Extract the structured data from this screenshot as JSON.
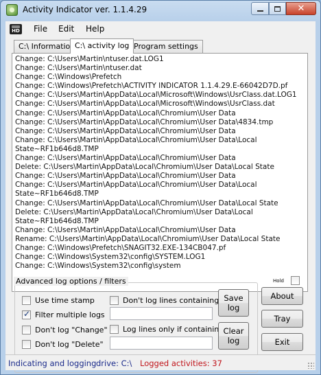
{
  "window": {
    "title": "Activity Indicator ver. 1.1.4.29"
  },
  "menu": {
    "file": "File",
    "edit": "Edit",
    "help": "Help",
    "logo_text": "HD"
  },
  "tabs": {
    "information": "C:\\ Information",
    "activity_log": "C:\\ activity log",
    "program_settings": "Program settings"
  },
  "log_lines": [
    "Change: C:\\Users\\Martin\\ntuser.dat.LOG1",
    "Change: C:\\Users\\Martin\\ntuser.dat",
    "Change: C:\\Windows\\Prefetch",
    "Change: C:\\Windows\\Prefetch\\ACTIVITY INDICATOR 1.1.4.29.E-66042D7D.pf",
    "Change: C:\\Users\\Martin\\AppData\\Local\\Microsoft\\Windows\\UsrClass.dat.LOG1",
    "Change: C:\\Users\\Martin\\AppData\\Local\\Microsoft\\Windows\\UsrClass.dat",
    "Change: C:\\Users\\Martin\\AppData\\Local\\Chromium\\User Data",
    "Change: C:\\Users\\Martin\\AppData\\Local\\Chromium\\User Data\\4834.tmp",
    "Change: C:\\Users\\Martin\\AppData\\Local\\Chromium\\User Data",
    "Change: C:\\Users\\Martin\\AppData\\Local\\Chromium\\User Data\\Local",
    "State~RF1b646d8.TMP",
    "Change: C:\\Users\\Martin\\AppData\\Local\\Chromium\\User Data",
    "Delete: C:\\Users\\Martin\\AppData\\Local\\Chromium\\User Data\\Local State",
    "Change: C:\\Users\\Martin\\AppData\\Local\\Chromium\\User Data",
    "Change: C:\\Users\\Martin\\AppData\\Local\\Chromium\\User Data\\Local",
    "State~RF1b646d8.TMP",
    "Change: C:\\Users\\Martin\\AppData\\Local\\Chromium\\User Data\\Local State",
    "Delete: C:\\Users\\Martin\\AppData\\Local\\Chromium\\User Data\\Local",
    "State~RF1b646d8.TMP",
    "Change: C:\\Users\\Martin\\AppData\\Local\\Chromium\\User Data",
    "Rename: C:\\Users\\Martin\\AppData\\Local\\Chromium\\User Data\\Local State",
    "Change: C:\\Windows\\Prefetch\\SNAGIT32.EXE-134CB047.pf",
    "Change: C:\\Windows\\System32\\config\\SYSTEM.LOG1",
    "Change: C:\\Windows\\System32\\config\\system"
  ],
  "hold_label": "Hold",
  "options": {
    "group_title": "Advanced log options / filters",
    "use_time_stamp": {
      "label": "Use time stamp",
      "checked": false
    },
    "filter_multiple_logs": {
      "label": "Filter multiple logs",
      "checked": true
    },
    "dont_log_change": {
      "label": "Don't log \"Change\"",
      "checked": false
    },
    "dont_log_delete": {
      "label": "Don't log \"Delete\"",
      "checked": false
    },
    "dont_log_lines_containing": {
      "label": "Don't log lines containing:",
      "checked": false,
      "value": ""
    },
    "log_lines_only_if_containing": {
      "label": "Log lines only if containing:",
      "checked": false,
      "value": ""
    }
  },
  "buttons": {
    "save_log": "Save\nlog",
    "clear_log": "Clear\nlog",
    "about": "About",
    "tray": "Tray",
    "exit": "Exit"
  },
  "status": {
    "state": "Indicating and logging",
    "drive": "drive: C:\\",
    "logged": "Logged activities: 37"
  },
  "colors": {
    "status_state": "#1a2a8a",
    "status_count": "#c0141a",
    "check_mark": "#1a3a7a"
  }
}
